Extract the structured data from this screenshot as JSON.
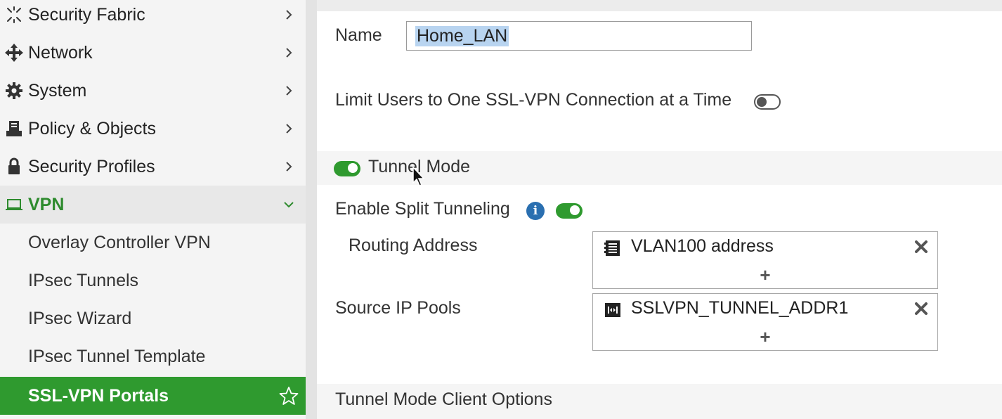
{
  "sidebar": {
    "items": [
      {
        "label": "Security Fabric",
        "icon": "security-fabric-icon"
      },
      {
        "label": "Network",
        "icon": "network-icon"
      },
      {
        "label": "System",
        "icon": "gear-icon"
      },
      {
        "label": "Policy & Objects",
        "icon": "policy-icon"
      },
      {
        "label": "Security Profiles",
        "icon": "lock-icon"
      }
    ],
    "vpn": {
      "label": "VPN",
      "icon": "laptop-icon"
    },
    "vpn_subitems": [
      "Overlay Controller VPN",
      "IPsec Tunnels",
      "IPsec Wizard",
      "IPsec Tunnel Template"
    ],
    "active": {
      "label": "SSL-VPN Portals"
    }
  },
  "form": {
    "name_label": "Name",
    "name_value": "Home_LAN",
    "limit_label": "Limit Users to One SSL-VPN Connection at a Time",
    "limit_enabled": false,
    "tunnel_mode_label": "Tunnel Mode",
    "tunnel_mode_enabled": true,
    "split_label": "Enable Split Tunneling",
    "split_enabled": true,
    "routing_label": "Routing Address",
    "routing_entry": "VLAN100 address",
    "source_label": "Source IP Pools",
    "source_entry": "SSLVPN_TUNNEL_ADDR1",
    "add_symbol": "+",
    "client_options_label": "Tunnel Mode Client Options"
  },
  "colors": {
    "accent_green": "#2f9a2f",
    "info_blue": "#2a6fb0"
  }
}
